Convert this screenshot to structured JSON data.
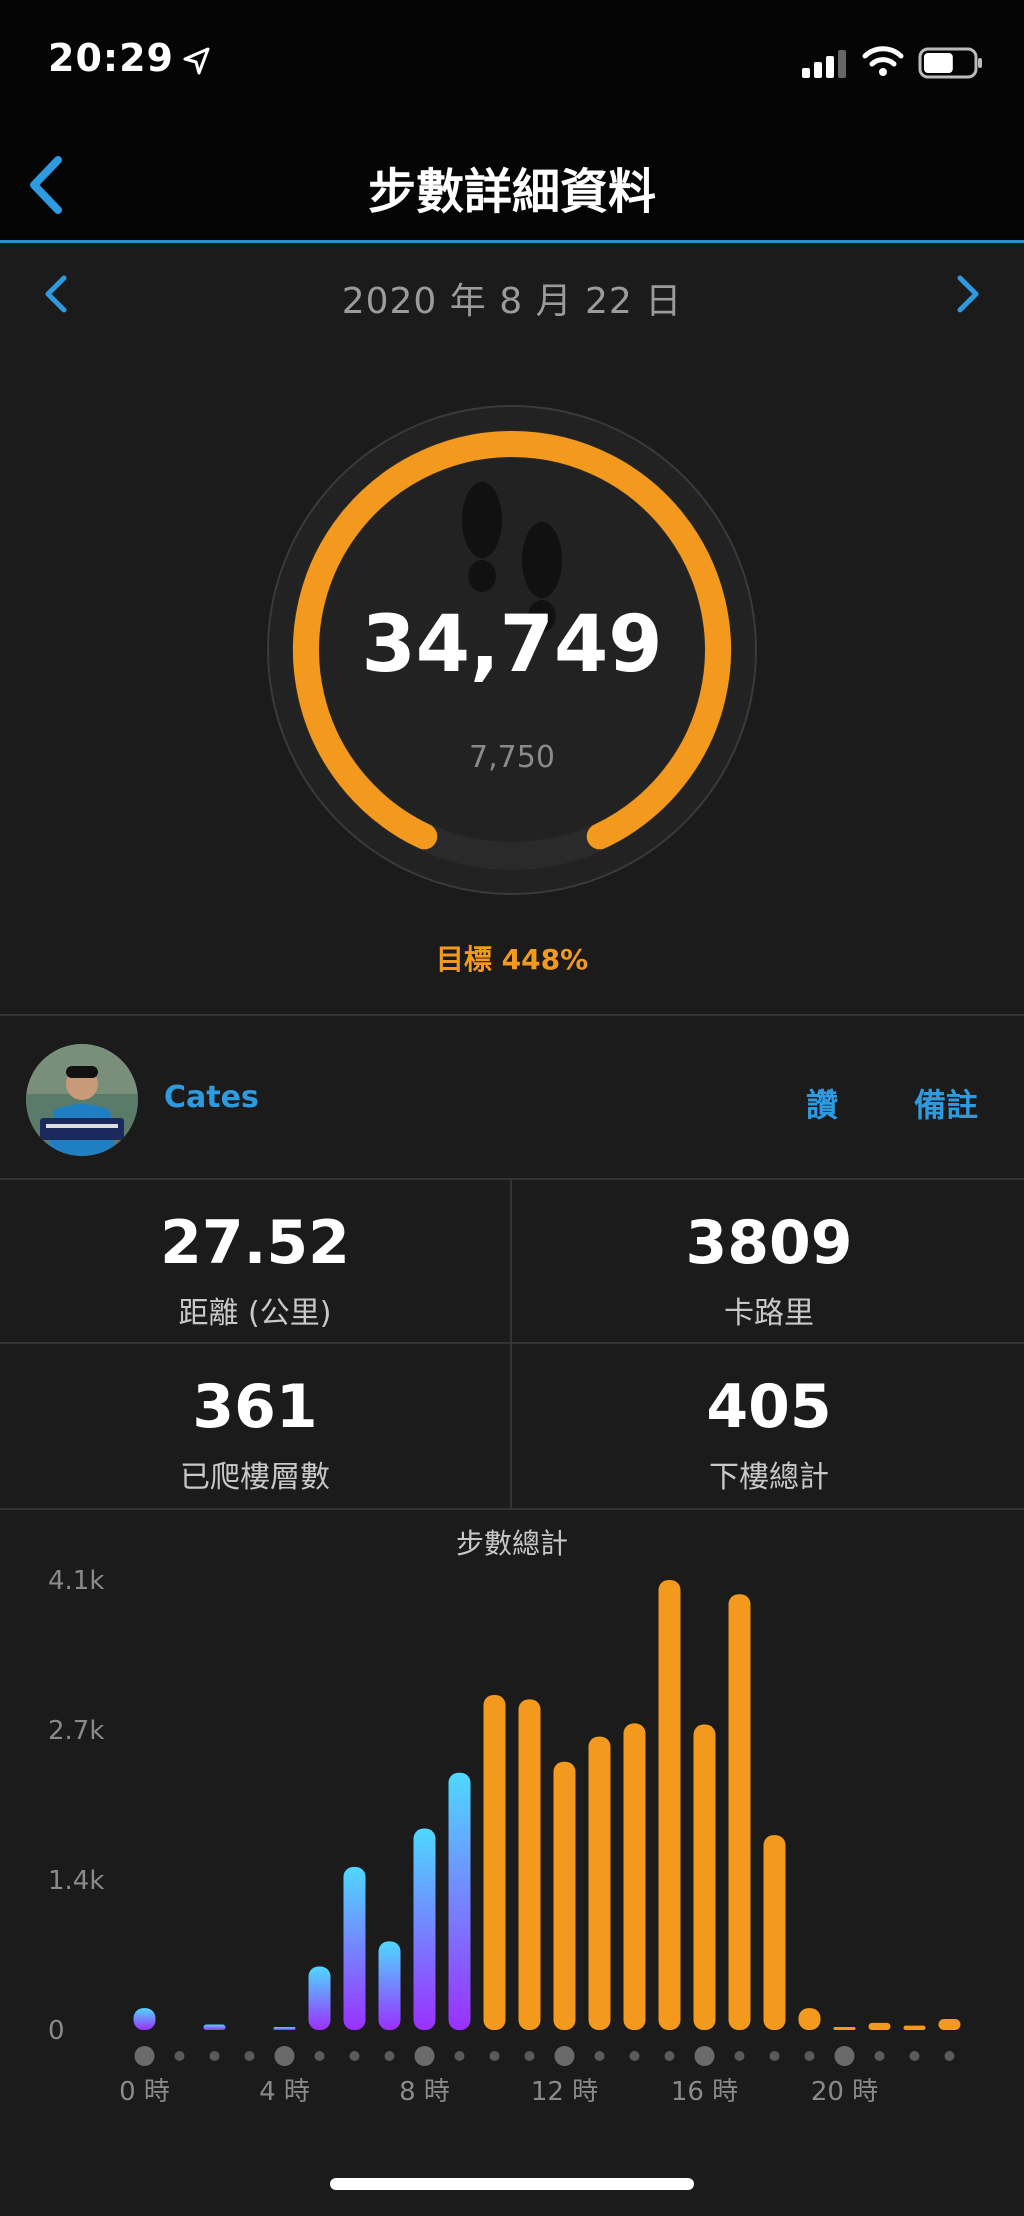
{
  "status_bar": {
    "time": "20:29",
    "location_icon": "location-arrow-icon",
    "signal_icon": "cellular-signal-icon",
    "wifi_icon": "wifi-icon",
    "battery_icon": "battery-icon",
    "battery_level": 0.6
  },
  "nav": {
    "title": "步數詳細資料",
    "back_icon": "chevron-left-icon"
  },
  "date_row": {
    "date": "2020 年 8 月 22 日",
    "prev_icon": "chevron-left-icon",
    "next_icon": "chevron-right-icon"
  },
  "summary": {
    "steps": "34,749",
    "secondary_value": "7,750",
    "goal_label": "目標",
    "goal_percent": "448%",
    "ring_progress": 0.86,
    "ring_color": "#f39a1e",
    "center_icon": "footprints-icon"
  },
  "user": {
    "name": "Cates",
    "like_label": "讚",
    "notes_label": "備註"
  },
  "stats": [
    {
      "value": "27.52",
      "label": "距離 (公里)"
    },
    {
      "value": "3809",
      "label": "卡路里"
    },
    {
      "value": "361",
      "label": "已爬樓層數"
    },
    {
      "value": "405",
      "label": "下樓總計"
    }
  ],
  "colors": {
    "accent_blue": "#2e9ae0",
    "accent_orange": "#f39a1e",
    "bar_gradient_start": "#9b30ff",
    "bar_gradient_end": "#4fd8ff"
  },
  "chart_data": {
    "type": "bar",
    "title": "步數總計",
    "x": [
      0,
      1,
      2,
      3,
      4,
      5,
      6,
      7,
      8,
      9,
      10,
      11,
      12,
      13,
      14,
      15,
      16,
      17,
      18,
      19,
      20,
      21,
      22,
      23
    ],
    "values": [
      200,
      0,
      50,
      0,
      20,
      580,
      1490,
      810,
      1840,
      2350,
      3060,
      3020,
      2450,
      2680,
      2800,
      4110,
      2790,
      3980,
      1780,
      200,
      15,
      65,
      40,
      100
    ],
    "bar_colors": [
      "gradient",
      "gradient",
      "gradient",
      "gradient",
      "gradient",
      "gradient",
      "gradient",
      "gradient",
      "gradient",
      "gradient",
      "orange",
      "orange",
      "orange",
      "orange",
      "orange",
      "orange",
      "orange",
      "orange",
      "orange",
      "orange",
      "orange",
      "orange",
      "orange",
      "orange"
    ],
    "y_ticks": [
      "0",
      "1.4k",
      "2.7k",
      "4.1k"
    ],
    "y_tick_values": [
      0,
      1370,
      2740,
      4110
    ],
    "x_ticks": [
      "0 時",
      "4 時",
      "8 時",
      "12 時",
      "16 時",
      "20 時"
    ],
    "x_tick_values": [
      0,
      4,
      8,
      12,
      16,
      20
    ],
    "ylim": [
      0,
      4110
    ]
  }
}
